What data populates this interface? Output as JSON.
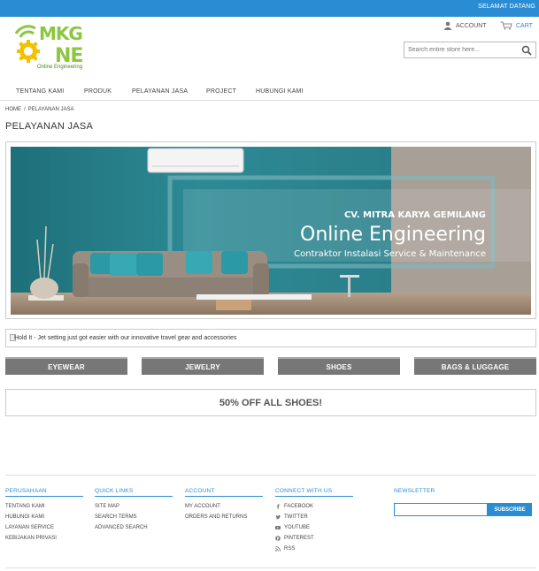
{
  "topbar": {
    "welcome": "SELAMAT DATANG"
  },
  "logo": {
    "tagline": "Online Engineering",
    "icon": "mkg-one-logo"
  },
  "header": {
    "account_label": "ACCOUNT",
    "cart_label": "CART",
    "account_icon": "user-icon",
    "cart_icon": "cart-icon",
    "search_placeholder": "Search entire store here...",
    "search_icon": "search-icon"
  },
  "nav": {
    "items": [
      {
        "label": "TENTANG KAMI"
      },
      {
        "label": "PRODUK"
      },
      {
        "label": "PELAYANAN JASA"
      },
      {
        "label": "PROJECT"
      },
      {
        "label": "HUBUNGI KAMI"
      }
    ]
  },
  "breadcrumb": {
    "home": "HOME",
    "separator": "/",
    "current": "PELAYANAN JASA"
  },
  "page": {
    "title": "PELAYANAN JASA"
  },
  "banner": {
    "company": "CV. MITRA  KARYA GEMILANG",
    "headline": "Online Engineering",
    "subline": "Contraktor Instalasi Service & Maintenance"
  },
  "promo": {
    "alt_text": "Hold It - Jet setting just got easier with our innovative travel gear and accessories"
  },
  "categories": [
    {
      "label": "EYEWEAR"
    },
    {
      "label": "JEWELRY"
    },
    {
      "label": "SHOES"
    },
    {
      "label": "BAGS & LUGGAGE"
    }
  ],
  "sale": {
    "text": "50% OFF ALL SHOES!"
  },
  "footer": {
    "columns": [
      {
        "heading": "PERUSAHAAN",
        "links": [
          "TENTANG KAMI",
          "HUBUNGI KAMI",
          "LAYANAN SERVICE",
          "KEBIJAKAN PRIVASI"
        ]
      },
      {
        "heading": "QUICK LINKS",
        "links": [
          "SITE MAP",
          "SEARCH TERMS",
          "ADVANCED SEARCH"
        ]
      },
      {
        "heading": "ACCOUNT",
        "links": [
          "MY ACCOUNT",
          "ORDERS AND RETURNS"
        ]
      },
      {
        "heading": "CONNECT WITH US",
        "links": [
          "FACEBOOK",
          "TWITTER",
          "YOUTUBE",
          "PINTEREST",
          "RSS"
        ]
      }
    ],
    "newsletter": {
      "heading": "NEWSLETTER",
      "button": "SUBSCRIBE"
    }
  },
  "colors": {
    "accent": "#2a8dd4",
    "brand_green": "#8cc63f",
    "category_bg": "#777777"
  }
}
